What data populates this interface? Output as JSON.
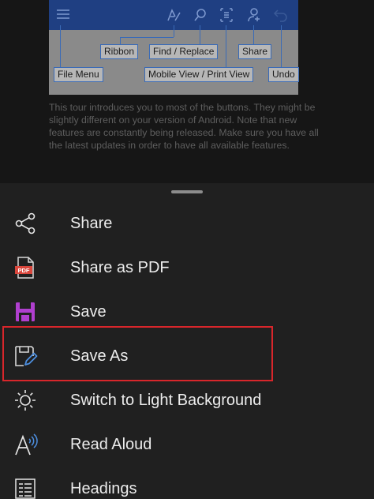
{
  "document": {
    "callouts": {
      "ribbon": "Ribbon",
      "find_replace": "Find / Replace",
      "share": "Share",
      "file_menu": "File Menu",
      "mobile_print_view": "Mobile View / Print View",
      "undo": "Undo"
    },
    "paragraph": "This tour introduces you to most of the buttons. They might be slightly different on your version of Android. Note that new features are constantly being released. Make sure you have all the latest updates in order to have all available features."
  },
  "menu": {
    "items": [
      {
        "label": "Share",
        "icon": "share-icon"
      },
      {
        "label": "Share as PDF",
        "icon": "pdf-icon",
        "icon_text": "PDF"
      },
      {
        "label": "Save",
        "icon": "save-icon"
      },
      {
        "label": "Save As",
        "icon": "save-as-icon",
        "highlighted": true
      },
      {
        "label": "Switch to Light Background",
        "icon": "sun-icon"
      },
      {
        "label": "Read Aloud",
        "icon": "read-aloud-icon"
      },
      {
        "label": "Headings",
        "icon": "headings-icon"
      }
    ]
  },
  "colors": {
    "sheet_background": "#202020",
    "highlight_border": "#d8262b",
    "save_icon": "#b03fcf",
    "pdf_icon": "#d9463c",
    "save_as_pen": "#4d8fe0"
  }
}
